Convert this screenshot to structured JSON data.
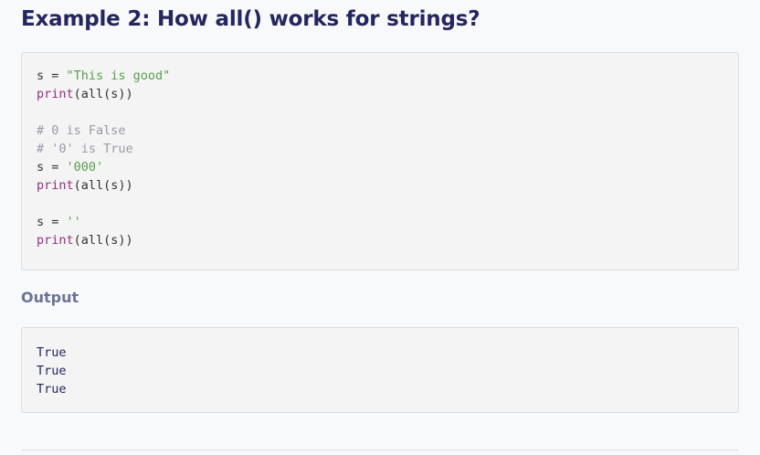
{
  "heading": "Example 2: How all() works for strings?",
  "code": {
    "lines": [
      [
        {
          "t": "s = ",
          "c": "pl"
        },
        {
          "t": "\"This is good\"",
          "c": "str"
        }
      ],
      [
        {
          "t": "print",
          "c": "fn"
        },
        {
          "t": "(all(s))",
          "c": "pl"
        }
      ],
      [],
      [
        {
          "t": "# 0 is False",
          "c": "cm"
        }
      ],
      [
        {
          "t": "# '0' is True",
          "c": "cm"
        }
      ],
      [
        {
          "t": "s = ",
          "c": "pl"
        },
        {
          "t": "'000'",
          "c": "str"
        }
      ],
      [
        {
          "t": "print",
          "c": "fn"
        },
        {
          "t": "(all(s))",
          "c": "pl"
        }
      ],
      [],
      [
        {
          "t": "s = ",
          "c": "pl"
        },
        {
          "t": "''",
          "c": "str"
        }
      ],
      [
        {
          "t": "print",
          "c": "fn"
        },
        {
          "t": "(all(s))",
          "c": "pl"
        }
      ]
    ]
  },
  "output_label": "Output",
  "output": {
    "lines": [
      "True",
      "True",
      "True"
    ]
  },
  "colors": {
    "heading": "#25265e",
    "string": "#5a9e4f",
    "function": "#96317e",
    "comment": "#9a9aa5",
    "output_label": "#6c7395"
  }
}
